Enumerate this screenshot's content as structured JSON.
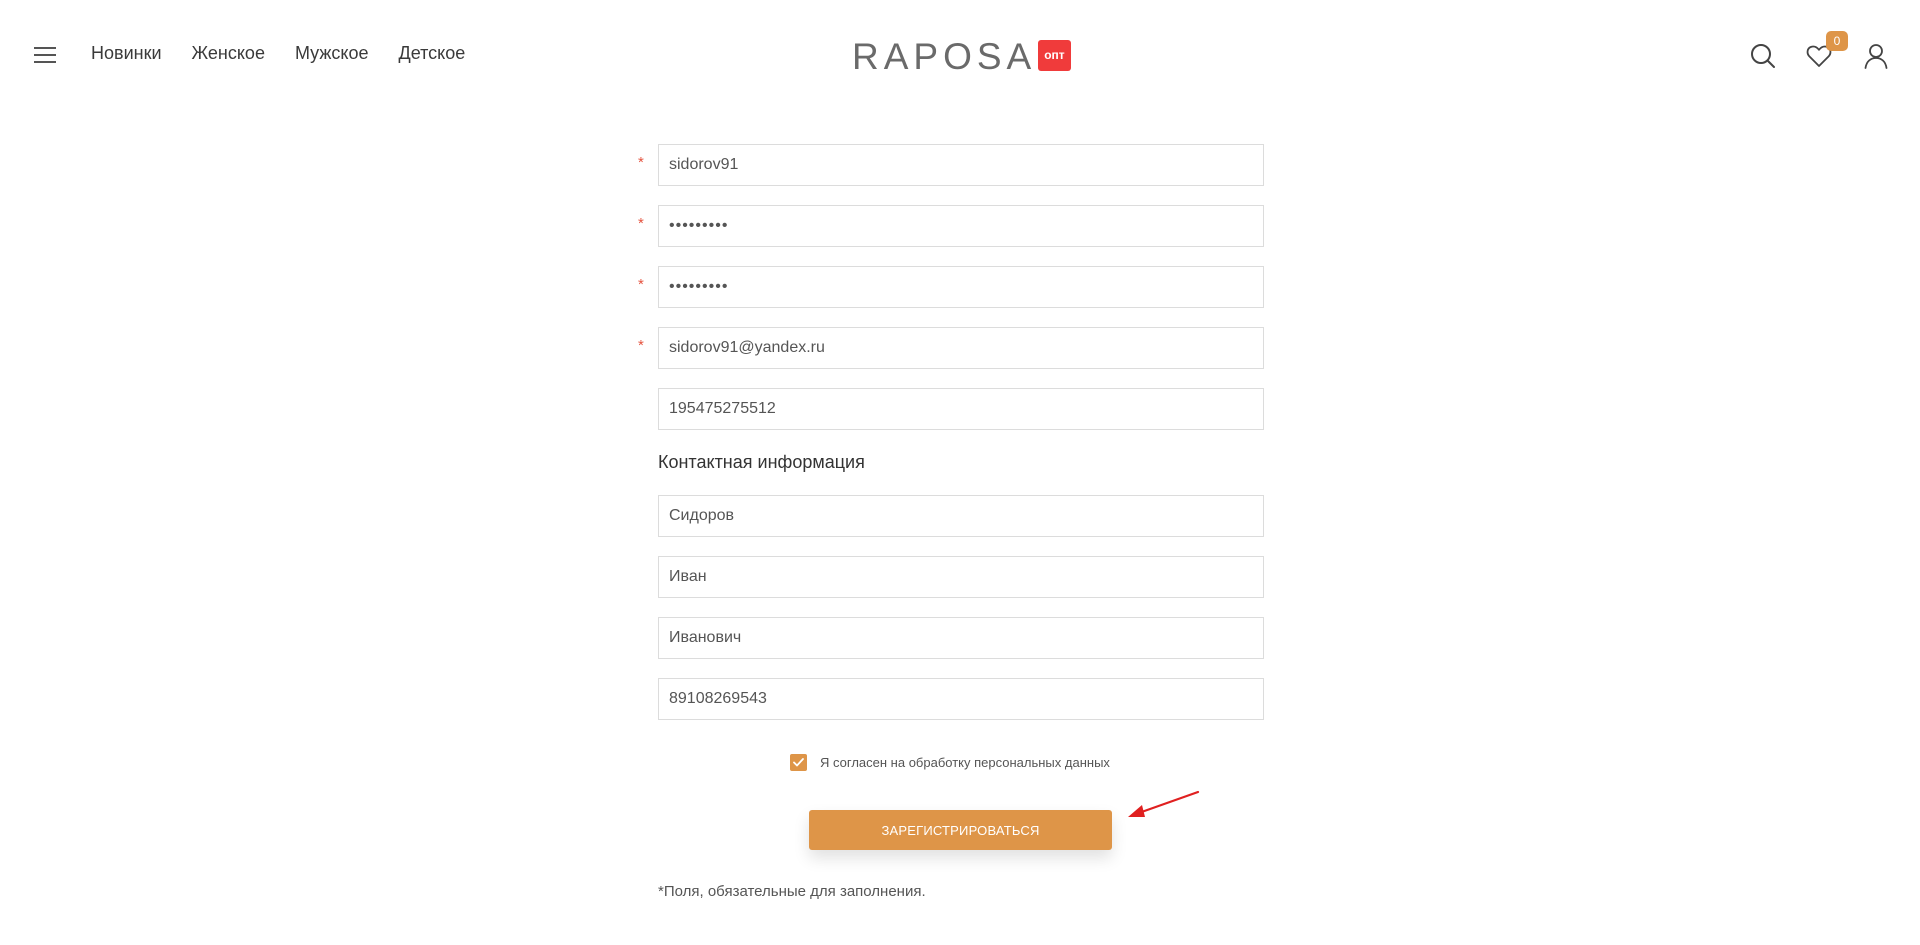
{
  "header": {
    "nav": [
      "Новинки",
      "Женское",
      "Мужское",
      "Детское"
    ],
    "logo_text": "RAPOSA",
    "logo_badge": "опт",
    "favorites_count": "0"
  },
  "form": {
    "login": "sidorov91",
    "password_mask": "•••••••••",
    "password_confirm_mask": "•••••••••",
    "email": "sidorov91@yandex.ru",
    "inn": "195475275512",
    "contact_title": "Контактная информация",
    "last_name": "Сидоров",
    "first_name": "Иван",
    "middle_name": "Иванович",
    "phone": "89108269543",
    "required_mark": "*",
    "agree_label": "Я согласен на обработку персональных данных",
    "agree_checked": true,
    "submit_label": "ЗАРЕГИСТРИРОВАТЬСЯ",
    "required_note": "*Поля, обязательные для заполнения."
  },
  "colors": {
    "accent": "#de9548",
    "badge_red": "#f03b3b",
    "required": "#e5533f",
    "annotation_arrow": "#e02020"
  }
}
